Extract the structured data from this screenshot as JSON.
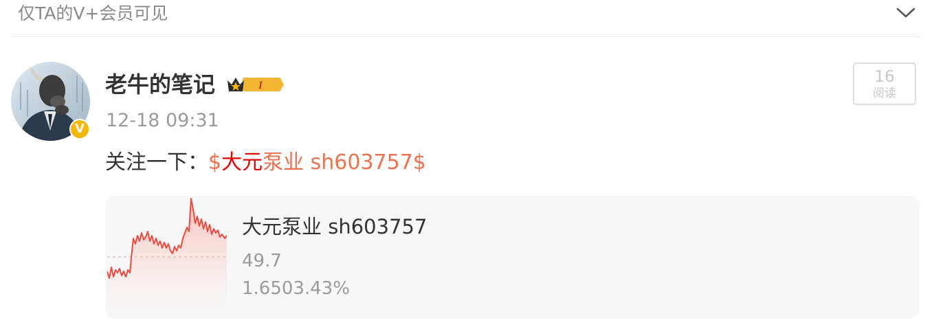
{
  "header": {
    "title": "仅TA的V+会员可见"
  },
  "author": {
    "name": "老牛的笔记",
    "time": "12-18 09:31",
    "badge_letter": "V",
    "level": "I"
  },
  "reads": {
    "count": "16",
    "label": "阅读"
  },
  "post": {
    "prefix": "关注一下：",
    "ticker_dollar_open": "$",
    "ticker_highlight": "大元",
    "ticker_rest": "泵业 sh603757",
    "ticker_dollar_close": "$"
  },
  "stock_card": {
    "name": "大元泵业 sh603757",
    "price": "49.7",
    "change": "1.6503.43%"
  },
  "colors": {
    "ticker_orange": "#eb7350",
    "ticker_red": "#e60000",
    "spark_line": "#f04a3e",
    "badge_gold": "#f5b800"
  },
  "icons": {
    "collapse": "chevron-down-icon",
    "verified": "verified-v-badge-icon",
    "level": "crown-level-icon"
  }
}
